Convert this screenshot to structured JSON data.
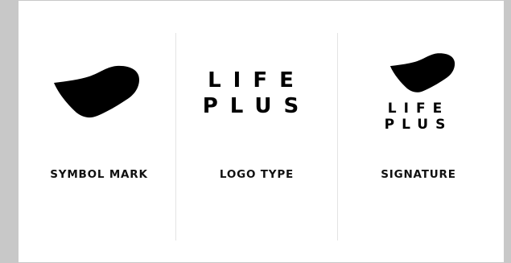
{
  "brand": {
    "colors": {
      "mark": "#000000",
      "background": "#ffffff",
      "divider": "#e4e4e4",
      "frame": "#c8c8c8"
    },
    "wordmark": {
      "line1": "LIFE",
      "line2": "PLUS"
    }
  },
  "panels": [
    {
      "caption": "SYMBOL MARK",
      "icon": "blob-symbol-icon"
    },
    {
      "caption": "LOGO TYPE"
    },
    {
      "caption": "SIGNATURE",
      "icon": "blob-symbol-icon"
    }
  ]
}
